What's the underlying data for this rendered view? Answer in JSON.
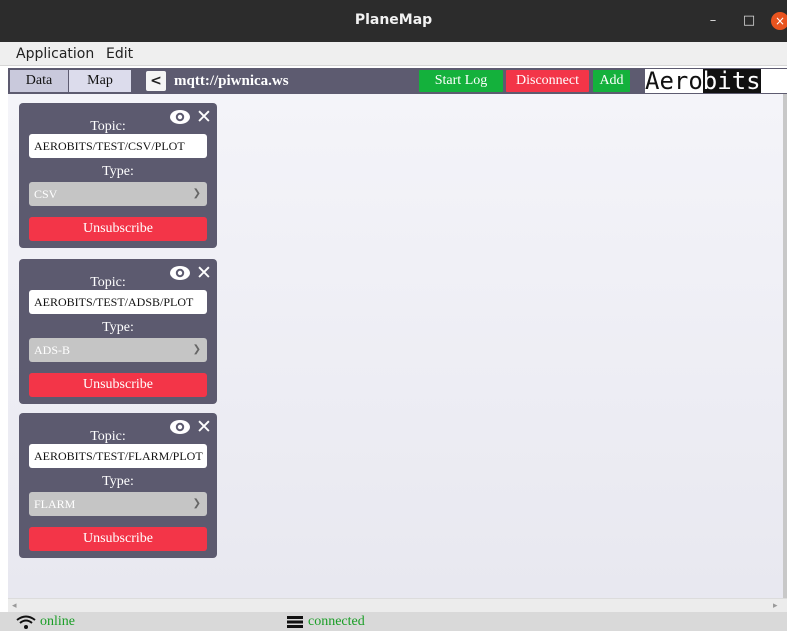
{
  "window": {
    "title": "PlaneMap",
    "minimize_glyph": "–",
    "maximize_glyph": "□",
    "close_glyph": "×"
  },
  "menu": {
    "items": [
      "Application",
      "Edit"
    ]
  },
  "toolbar": {
    "tabs": [
      "Data",
      "Map"
    ],
    "active_tab": "Map",
    "back_glyph": "<",
    "url": "mqtt://piwnica.ws",
    "start_log_label": "Start Log",
    "disconnect_label": "Disconnect",
    "add_label": "Add",
    "logo_part1": "Aero",
    "logo_part2": "bits"
  },
  "subscriptions": [
    {
      "topic_label": "Topic:",
      "topic": "AEROBITS/TEST/CSV/PLOT",
      "type_label": "Type:",
      "type": "CSV",
      "unsubscribe_label": "Unsubscribe"
    },
    {
      "topic_label": "Topic:",
      "topic": "AEROBITS/TEST/ADSB/PLOT",
      "type_label": "Type:",
      "type": "ADS-B",
      "unsubscribe_label": "Unsubscribe"
    },
    {
      "topic_label": "Topic:",
      "topic": "AEROBITS/TEST/FLARM/PLOT",
      "type_label": "Type:",
      "type": "FLARM",
      "unsubscribe_label": "Unsubscribe"
    }
  ],
  "status": {
    "network": "online",
    "connection": "connected"
  },
  "colors": {
    "green": "#14b13c",
    "red": "#f33548",
    "panel": "#5c5a6f",
    "status_green": "#1a9e26"
  }
}
